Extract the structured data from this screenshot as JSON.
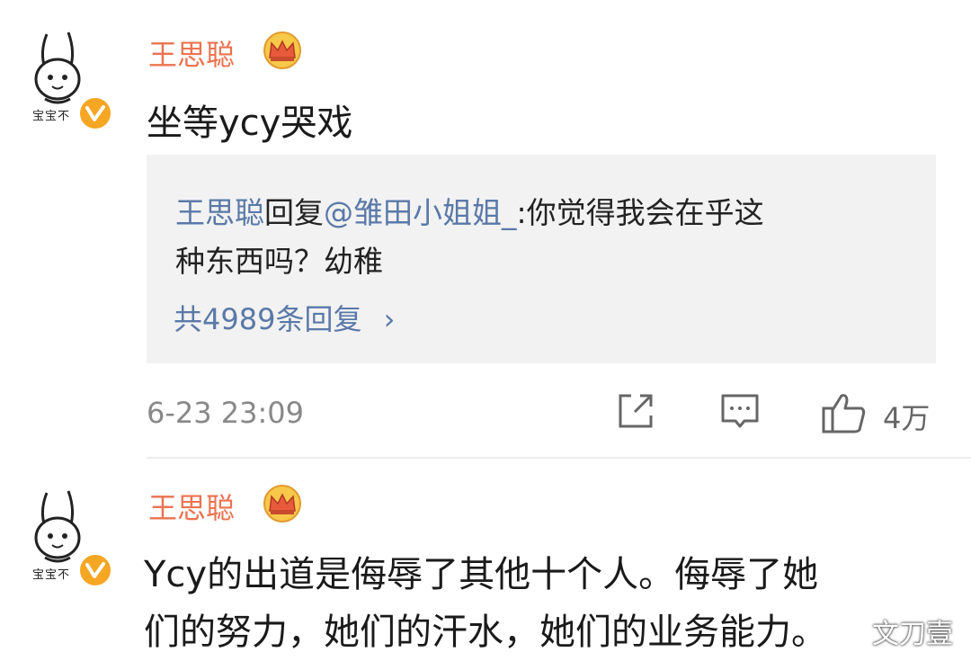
{
  "comments": [
    {
      "avatar_caption": "宝宝不",
      "username": "王思聪",
      "text": "坐等ycy哭戏",
      "reply": {
        "author": "王思聪",
        "verb": "回复",
        "mention": "@雏田小姐姐_",
        "content_line1": ":你觉得我会在乎这",
        "content_line2": "种东西吗？幼稚",
        "count_label": "共4989条回复",
        "arrow": "›"
      },
      "timestamp": "6-23 23:09",
      "like_count": "4万"
    },
    {
      "avatar_caption": "宝宝不",
      "username": "王思聪",
      "text_line1": "Ycy的出道是侮辱了其他十个人。侮辱了她",
      "text_line2": "们的努力，她们的汗水，她们的业务能力。"
    }
  ],
  "watermark": {
    "text": "文刀壹"
  },
  "colors": {
    "username": "#eb7350",
    "link": "#5a79a8",
    "reply_bg": "#f2f2f2",
    "badge": "#f5a623"
  },
  "icons": [
    "share-icon",
    "comment-icon",
    "like-icon",
    "verified-badge-icon",
    "crown-icon",
    "wechat-icon"
  ]
}
